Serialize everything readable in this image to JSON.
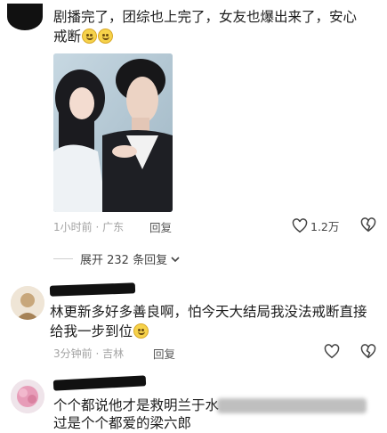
{
  "comments": [
    {
      "text": "剧播完了，团综也上完了，女友也爆出来了，安心戒断",
      "time": "1小时前",
      "location": "广东",
      "reply_label": "回复",
      "likes": "1.2万"
    },
    {
      "text": "林更新多好多善良啊，怕今天大结局我没法戒断直接给我一步到位",
      "time": "3分钟前",
      "location": "吉林",
      "reply_label": "回复"
    },
    {
      "text_line1": "个个都说他才是救明兰于水",
      "text_line2": "过是个个都爱的梁六郎"
    }
  ],
  "expand_replies": "展开 232 条回复",
  "meta_separator": " · ",
  "icons": {
    "like": "heart-outline-icon",
    "dislike": "broken-heart-icon",
    "expand": "chevron-down-icon"
  }
}
